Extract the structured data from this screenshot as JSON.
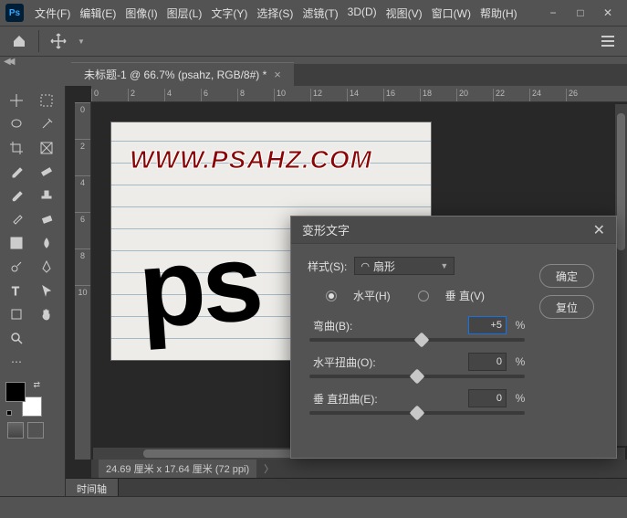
{
  "title": {
    "app": "Ps"
  },
  "menu": [
    "文件(F)",
    "编辑(E)",
    "图像(I)",
    "图层(L)",
    "文字(Y)",
    "选择(S)",
    "滤镜(T)",
    "3D(D)",
    "视图(V)",
    "窗口(W)",
    "帮助(H)"
  ],
  "tab": {
    "label": "未标题-1 @ 66.7% (psahz, RGB/8#) *"
  },
  "ruler_h": [
    "0",
    "2",
    "4",
    "6",
    "8",
    "10",
    "12",
    "14",
    "16",
    "18",
    "20",
    "22",
    "24",
    "26"
  ],
  "ruler_v": [
    "0",
    "2",
    "4",
    "6",
    "8",
    "10"
  ],
  "canvas": {
    "watermark": "WWW.PSAHZ.COM",
    "text": "ps"
  },
  "status": {
    "dims": "24.69 厘米 x 17.64 厘米 (72 ppi)"
  },
  "panel": {
    "timeline": "时间轴"
  },
  "dialog": {
    "title": "变形文字",
    "style_label": "样式(S):",
    "style_value": "扇形",
    "horiz": "水平(H)",
    "vert": "垂 直(V)",
    "bend_label": "弯曲(B):",
    "bend_value": "+5",
    "hdist_label": "水平扭曲(O):",
    "hdist_value": "0",
    "vdist_label": "垂 直扭曲(E):",
    "vdist_value": "0",
    "pct": "%",
    "ok": "确定",
    "reset": "复位"
  }
}
